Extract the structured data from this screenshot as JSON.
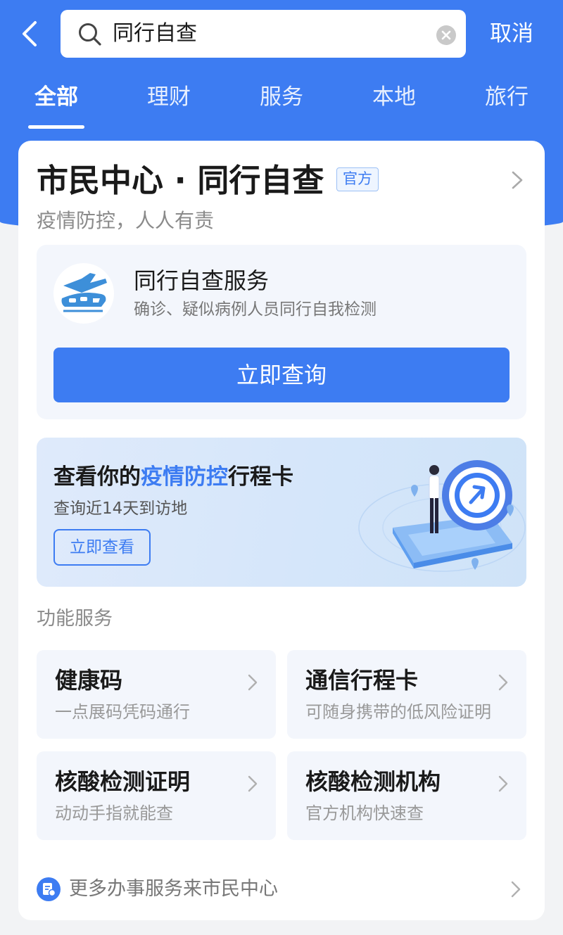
{
  "search": {
    "query": "同行自查",
    "cancel_label": "取消"
  },
  "tabs": [
    {
      "label": "全部",
      "active": true
    },
    {
      "label": "理财",
      "active": false
    },
    {
      "label": "服务",
      "active": false
    },
    {
      "label": "本地",
      "active": false
    },
    {
      "label": "旅行",
      "active": false
    }
  ],
  "card": {
    "title": "市民中心 · 同行自查",
    "badge": "官方",
    "subtitle": "疫情防控，人人有责",
    "service": {
      "name": "同行自查服务",
      "desc": "确诊、疑似病例人员同行自我检测",
      "button_label": "立即查询"
    },
    "banner": {
      "title_pre": "查看你的",
      "title_highlight": "疫情防控",
      "title_post": "行程卡",
      "subtitle": "查询近14天到访地",
      "button_label": "立即查看"
    },
    "section_title": "功能服务",
    "features": [
      {
        "name": "健康码",
        "desc": "一点展码凭码通行"
      },
      {
        "name": "通信行程卡",
        "desc": "可随身携带的低风险证明"
      },
      {
        "name": "核酸检测证明",
        "desc": "动动手指就能查"
      },
      {
        "name": "核酸检测机构",
        "desc": "官方机构快速查"
      }
    ],
    "more_label": "更多办事服务来市民中心"
  },
  "colors": {
    "accent": "#3d7cf2",
    "background": "#f2f3f5"
  }
}
